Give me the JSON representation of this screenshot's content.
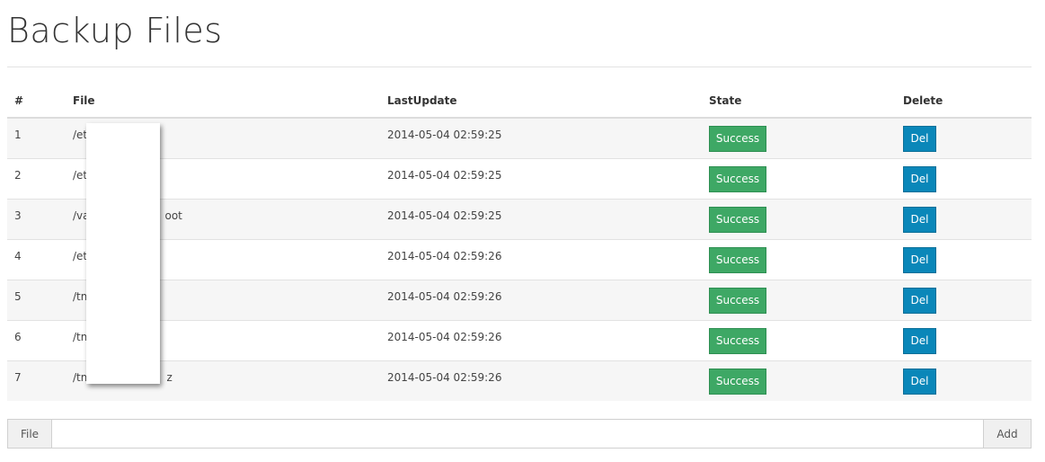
{
  "page": {
    "title": "Backup Files"
  },
  "table": {
    "headers": {
      "num": "#",
      "file": "File",
      "last_update": "LastUpdate",
      "state": "State",
      "delete": "Delete"
    },
    "rows": [
      {
        "num": "1",
        "file": "/et",
        "file_suffix": "",
        "last_update": "2014-05-04 02:59:25",
        "state": "Success",
        "delete": "Del"
      },
      {
        "num": "2",
        "file": "/et",
        "file_suffix": "",
        "last_update": "2014-05-04 02:59:25",
        "state": "Success",
        "delete": "Del"
      },
      {
        "num": "3",
        "file": "/va",
        "file_suffix": "oot",
        "last_update": "2014-05-04 02:59:25",
        "state": "Success",
        "delete": "Del"
      },
      {
        "num": "4",
        "file": "/et",
        "file_suffix": "",
        "last_update": "2014-05-04 02:59:26",
        "state": "Success",
        "delete": "Del"
      },
      {
        "num": "5",
        "file": "/tm",
        "file_suffix": "",
        "last_update": "2014-05-04 02:59:26",
        "state": "Success",
        "delete": "Del"
      },
      {
        "num": "6",
        "file": "/tm",
        "file_suffix": "",
        "last_update": "2014-05-04 02:59:26",
        "state": "Success",
        "delete": "Del"
      },
      {
        "num": "7",
        "file": "/tm",
        "file_suffix": "z",
        "last_update": "2014-05-04 02:59:26",
        "state": "Success",
        "delete": "Del"
      }
    ]
  },
  "form": {
    "file_label": "File",
    "file_value": "",
    "add_label": "Add"
  },
  "colors": {
    "success": "#3ea865",
    "delete": "#0a87b9"
  }
}
